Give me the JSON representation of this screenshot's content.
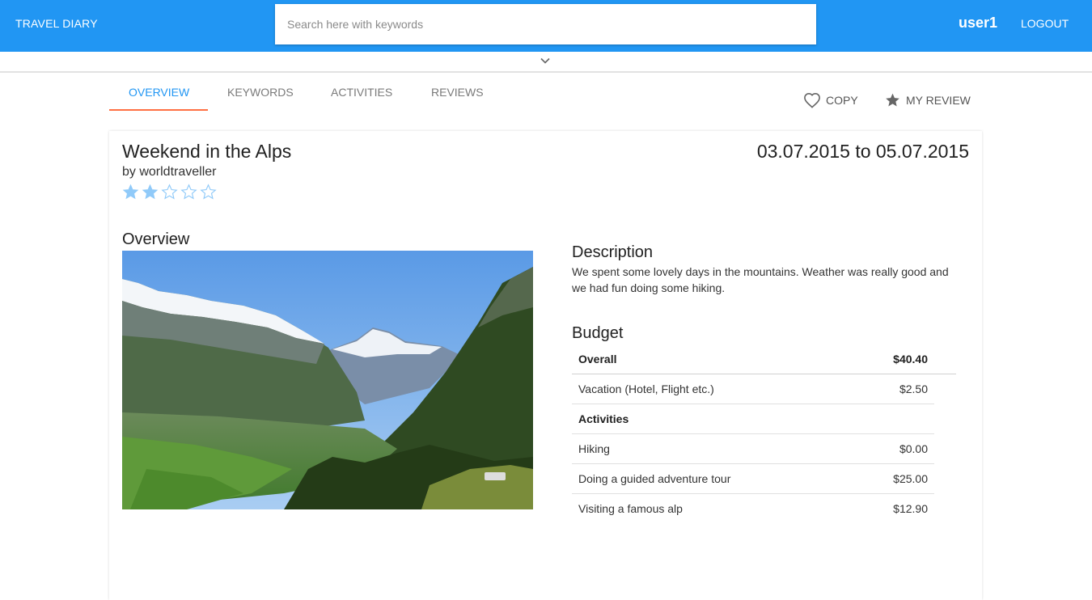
{
  "header": {
    "brand": "TRAVEL DIARY",
    "search_placeholder": "Search here with keywords",
    "username": "user1",
    "logout_label": "LOGOUT",
    "bar_color": "#2196f3"
  },
  "tabs": [
    {
      "label": "OVERVIEW",
      "active": true
    },
    {
      "label": "KEYWORDS",
      "active": false
    },
    {
      "label": "ACTIVITIES",
      "active": false
    },
    {
      "label": "REVIEWS",
      "active": false
    }
  ],
  "actions": {
    "copy_label": "COPY",
    "copy_icon": "heart-outline-icon",
    "review_label": "MY REVIEW",
    "review_icon": "star-icon"
  },
  "trip": {
    "title": "Weekend in the Alps",
    "author": "by worldtraveller",
    "rating": 2,
    "rating_max": 5,
    "dates": "03.07.2015 to 05.07.2015"
  },
  "overview": {
    "heading": "Overview"
  },
  "description": {
    "heading": "Description",
    "text": "We spent some lovely days in the mountains. Weather was really good and we had fun doing some hiking."
  },
  "budget": {
    "heading": "Budget",
    "overall_label": "Overall",
    "overall_value": "$40.40",
    "rows": [
      {
        "label": "Vacation (Hotel, Flight etc.)",
        "value": "$2.50"
      },
      {
        "label": "Activities",
        "value": ""
      },
      {
        "label": "Hiking",
        "value": "$0.00"
      },
      {
        "label": "Doing a guided adventure tour",
        "value": "$25.00"
      },
      {
        "label": "Visiting a famous alp",
        "value": "$12.90"
      }
    ]
  }
}
